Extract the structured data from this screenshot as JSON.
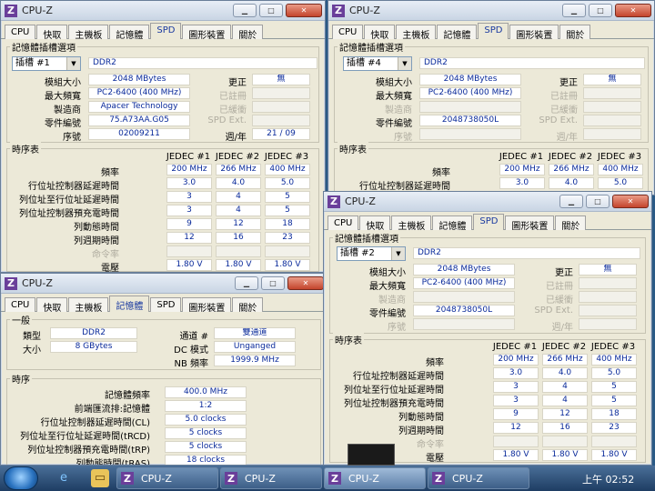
{
  "app_title": "CPU-Z",
  "tabs": [
    "CPU",
    "快取",
    "主機板",
    "記憶體",
    "SPD",
    "圖形裝置",
    "關於"
  ],
  "spd": {
    "group_slot": "記憶體插槽選項",
    "labels": {
      "module_size": "模組大小",
      "max_bw": "最大頻寬",
      "manufacturer": "製造商",
      "part_number": "零件編號",
      "serial": "序號",
      "correction": "更正",
      "registered": "已註冊",
      "buffered": "已緩衝",
      "spd_ext": "SPD Ext.",
      "week_year": "週/年"
    },
    "timing_group": "時序表",
    "jedec_headers": [
      "JEDEC #1",
      "JEDEC #2",
      "JEDEC #3"
    ],
    "timing_labels": [
      "頻率",
      "行位址控制器延遲時間",
      "列位址至行位址延遲時間",
      "列位址控制器預充電時間",
      "列動態時間",
      "列週期時間",
      "命令率",
      "電壓"
    ]
  },
  "win1": {
    "slot": "插槽 #1",
    "type": "DDR2",
    "module_size": "2048 MBytes",
    "max_bw": "PC2-6400 (400 MHz)",
    "manufacturer": "Apacer Technology",
    "part_number": "75.A73AA.G05",
    "serial": "02009211",
    "correction": "無",
    "week_year": "21 / 09",
    "timings": [
      [
        "200 MHz",
        "266 MHz",
        "400 MHz"
      ],
      [
        "3.0",
        "4.0",
        "5.0"
      ],
      [
        "3",
        "4",
        "5"
      ],
      [
        "3",
        "4",
        "5"
      ],
      [
        "9",
        "12",
        "18"
      ],
      [
        "12",
        "16",
        "23"
      ],
      [
        "",
        "",
        ""
      ],
      [
        "1.80 V",
        "1.80 V",
        "1.80 V"
      ]
    ]
  },
  "win2": {
    "slot": "插槽 #4",
    "type": "DDR2",
    "module_size": "2048 MBytes",
    "max_bw": "PC2-6400 (400 MHz)",
    "manufacturer": "",
    "part_number": "2048738050L",
    "serial": "",
    "correction": "無",
    "week_year": "",
    "timings": [
      [
        "200 MHz",
        "266 MHz",
        "400 MHz"
      ],
      [
        "3.0",
        "4.0",
        "5.0"
      ]
    ]
  },
  "win3": {
    "slot": "插槽 #2",
    "type": "DDR2",
    "module_size": "2048 MBytes",
    "max_bw": "PC2-6400 (400 MHz)",
    "manufacturer": "",
    "part_number": "2048738050L",
    "serial": "",
    "correction": "無",
    "week_year": "",
    "timings": [
      [
        "200 MHz",
        "266 MHz",
        "400 MHz"
      ],
      [
        "3.0",
        "4.0",
        "5.0"
      ],
      [
        "3",
        "4",
        "5"
      ],
      [
        "3",
        "4",
        "5"
      ],
      [
        "9",
        "12",
        "18"
      ],
      [
        "12",
        "16",
        "23"
      ],
      [
        "",
        "",
        ""
      ],
      [
        "1.80 V",
        "1.80 V",
        "1.80 V"
      ]
    ]
  },
  "mem": {
    "general": "一般",
    "type_label": "類型",
    "type": "DDR2",
    "size_label": "大小",
    "size": "8 GBytes",
    "channel_label": "通道 #",
    "channel": "雙通道",
    "dc_label": "DC 模式",
    "dc": "Unganged",
    "nb_label": "NB 頻率",
    "nb": "1999.9 MHz",
    "timing_group": "時序",
    "rows": [
      [
        "記憶體頻率",
        "400.0 MHz"
      ],
      [
        "前端匯流排:記憶體",
        "1:2"
      ],
      [
        "行位址控制器延遲時間(CL)",
        "5.0 clocks"
      ],
      [
        "列位址至行位址延遲時間(tRCD)",
        "5 clocks"
      ],
      [
        "列位址控制器預充電時間(tRP)",
        "5 clocks"
      ],
      [
        "列動態時間(tRAS)",
        "18 clocks"
      ]
    ]
  },
  "taskbar": {
    "items": [
      "CPU-Z",
      "CPU-Z",
      "CPU-Z",
      "CPU-Z"
    ],
    "clock": "上午 02:52"
  }
}
